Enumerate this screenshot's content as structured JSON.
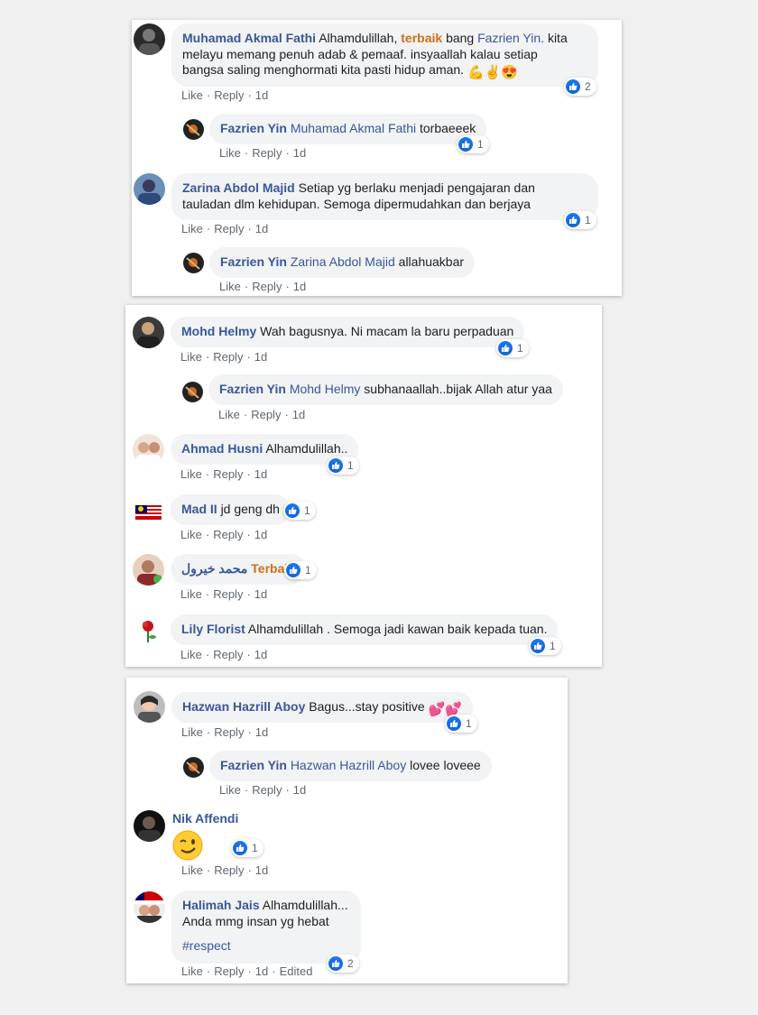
{
  "common": {
    "like": "Like",
    "reply": "Reply",
    "time": "1d",
    "sep": "·",
    "edited": "Edited"
  },
  "c1": {
    "name": "Muhamad Akmal Fathi",
    "t1": "Alhamdulillah,",
    "highlight": "terbaik",
    "t2": "bang",
    "mention": "Fazrien Yin.",
    "t3": "kita",
    "line2": "melayu memang penuh adab & pemaaf. insyaallah kalau setiap",
    "line3": "bangsa saling menghormati kita pasti hidup aman.",
    "reactions": "2"
  },
  "r1": {
    "name": "Fazrien Yin",
    "mention": "Muhamad Akmal Fathi",
    "text": "torbaeeek",
    "reactions": "1"
  },
  "c2": {
    "name": "Zarina Abdol Majid",
    "line1": "Setiap yg berlaku menjadi pengajaran dan",
    "line2": "tauladan dlm kehidupan. Semoga dipermudahkan dan berjaya",
    "reactions": "1"
  },
  "r2": {
    "name": "Fazrien Yin",
    "mention": "Zarina Abdol Majid",
    "text": "allahuakbar"
  },
  "c3": {
    "name": "Mohd Helmy",
    "text": "Wah bagusnya. Ni macam la baru perpaduan",
    "reactions": "1"
  },
  "r3": {
    "name": "Fazrien Yin",
    "mention": "Mohd Helmy",
    "text": "subhanaallah..bijak Allah atur yaa"
  },
  "c4": {
    "name": "Ahmad Husni",
    "text": "Alhamdulillah..",
    "reactions": "1"
  },
  "c5": {
    "name": "Mad II",
    "text": "jd geng dh",
    "reactions": "1"
  },
  "c6": {
    "name": "محمد خيرول",
    "highlight": "Terbaik",
    "reactions": "1"
  },
  "c7": {
    "name": "Lily Florist",
    "text": "Alhamdulillah . Semoga jadi kawan baik kepada tuan.",
    "reactions": "1"
  },
  "c8": {
    "name": "Hazwan Hazrill Aboy",
    "text": "Bagus...stay positive",
    "reactions": "1"
  },
  "r4": {
    "name": "Fazrien Yin",
    "mention": "Hazwan Hazrill Aboy",
    "text": "lovee loveee"
  },
  "c9": {
    "name": "Nik Affendi",
    "reactions": "1"
  },
  "c10": {
    "name": "Halimah Jais",
    "line1": "Alhamdulillah...",
    "line2": "Anda mmg insan yg hebat",
    "hashtag": "#respect",
    "reactions": "2"
  },
  "icons": {
    "like": "like-icon",
    "wink": "wink-emoji-icon",
    "heart": "heart-emoji-icon"
  }
}
